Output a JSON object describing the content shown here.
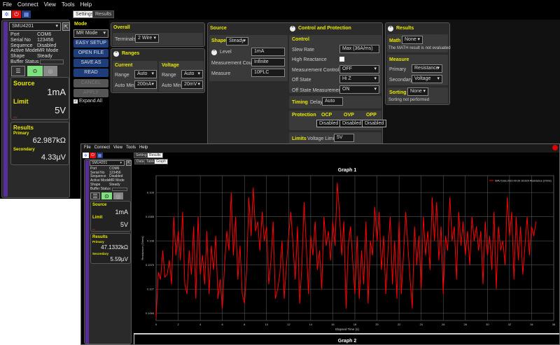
{
  "menu": [
    "File",
    "Connect",
    "View",
    "Tools",
    "Help"
  ],
  "tabs": {
    "settings": "Settings",
    "results": "Results",
    "data": "Data",
    "table": "Table",
    "graph": "Graph"
  },
  "device": {
    "name": "SMU4201",
    "fields": [
      {
        "k": "Port",
        "v": "COM6"
      },
      {
        "k": "Serial No",
        "v": "123456"
      },
      {
        "k": "Sequence",
        "v": "Disabled"
      },
      {
        "k": "Active Mode",
        "v": "MR Mode"
      },
      {
        "k": "Shape",
        "v": "Steady"
      },
      {
        "k": "Buffer Status",
        "v": ""
      }
    ]
  },
  "status": {
    "source_label": "Source",
    "source_value": "1mA",
    "limit_label": "Limit",
    "limit_value": "5V",
    "hv": "HV",
    "results_label": "Results",
    "primary_label": "Primary",
    "primary_value": "62.987kΩ",
    "secondary_label": "Secondary",
    "secondary_value": "4.33µV"
  },
  "status2": {
    "primary_value": "47.1332kΩ",
    "secondary_value": "5.59µV"
  },
  "mode": {
    "label": "Mode",
    "value": "MR Mode",
    "buttons": [
      "EASY SETUP",
      "OPEN FILE",
      "SAVE AS",
      "READ",
      "CANCEL",
      "APPLY"
    ],
    "expand_all": "Expand All"
  },
  "overall": {
    "title": "Overall",
    "terminals_label": "Terminals",
    "terminals": "2 Wire"
  },
  "ranges": {
    "title": "Ranges",
    "current": "Current",
    "voltage": "Voltage",
    "range": "Range",
    "automin": "Auto Min",
    "cur_range": "Auto",
    "cur_min": "200nA",
    "volt_range": "Auto",
    "volt_min": "20mV"
  },
  "source": {
    "title": "Source",
    "shape_label": "Shape",
    "shape": "Steady",
    "level_label": "Level",
    "level": "1mA",
    "count_label": "Measurement Count",
    "count": "Infinite",
    "measure_label": "Measure",
    "measure": "10PLC"
  },
  "control": {
    "title": "Control and Protection",
    "control": "Control",
    "slew_label": "Slew Rate",
    "slew": "Max (36A/ms)",
    "hr_label": "High Reactance",
    "mc_label": "Measurement Control",
    "mc": "OFF",
    "off_label": "Off State",
    "off": "Hi Z",
    "osm_label": "Off State Measurements",
    "osm": "ON",
    "timing": "Timing",
    "delay_label": "Delay",
    "delay": "Auto",
    "protection": "Protection",
    "ocp": "OCP",
    "ovp": "OVP",
    "opp": "OPP",
    "disabled": "Disabled",
    "limits": "Limits",
    "vlimit_label": "Voltage Limit",
    "vlimit": "5V"
  },
  "results": {
    "title": "Results",
    "math_label": "Math",
    "math": "None",
    "math_note": "The MATH result is not evaluated",
    "measure": "Measure",
    "primary_label": "Primary",
    "primary": "Resistance",
    "secondary_label": "Secondary",
    "secondary": "Voltage",
    "sorting_label": "Sorting",
    "sorting": "None",
    "sorting_note": "Sorting not performed"
  },
  "graph2_title": "Graph 2",
  "colors": {
    "series": "#ff0000",
    "accent": "#e8e800",
    "mode_bar": "#5a2d9c"
  },
  "chart_data": {
    "type": "line",
    "title": "Graph 1",
    "xlabel": "Elapsed Time (s)",
    "ylabel": "Resistance (Ohms)",
    "xlim": [
      0,
      36
    ],
    "ylim": [
      0.10635,
      0.10935
    ],
    "xticks": [
      0,
      2,
      4,
      6,
      8,
      10,
      12,
      14,
      16,
      18,
      20,
      22,
      24,
      26,
      28,
      30,
      32,
      34,
      36
    ],
    "yticks": [
      0.1065,
      0.107,
      0.1075,
      0.108,
      0.1085,
      0.109
    ],
    "ytick_labels": [
      "0.1065",
      "0.107",
      "0.1075",
      "0.108",
      "0.1085",
      "0.109"
    ],
    "legend": "SMU Data 2022-09-26 161020 Resistance (Ohms)",
    "legend_position": "top-right",
    "grid": true,
    "series": [
      {
        "name": "SMU Data 2022-09-26 161020 Resistance (Ohms)",
        "x_step": 0.2,
        "values": [
          0.1064,
          0.10735,
          0.1072,
          0.1078,
          0.10725,
          0.1073,
          0.1076,
          0.1071,
          0.1085,
          0.1077,
          0.1082,
          0.1076,
          0.1086,
          0.1071,
          0.1069,
          0.1078,
          0.1073,
          0.1083,
          0.1068,
          0.1085,
          0.1073,
          0.1077,
          0.1071,
          0.1082,
          0.1069,
          0.1079,
          0.1074,
          0.1081,
          0.1068,
          0.1072,
          0.1066,
          0.1075,
          0.1082,
          0.1078,
          0.109,
          0.1077,
          0.1085,
          0.1072,
          0.1079,
          0.1069,
          0.1067,
          0.1074,
          0.1089,
          0.1081,
          0.1091,
          0.1082,
          0.1084,
          0.1078,
          0.1086,
          0.108,
          0.1083,
          0.1071,
          0.1076,
          0.1084,
          0.1068,
          0.107,
          0.1073,
          0.108,
          0.1068,
          0.1075,
          0.1081,
          0.1086,
          0.1079,
          0.1072,
          0.1083,
          0.1067,
          0.1075,
          0.1088,
          0.1079,
          0.1069,
          0.1081,
          0.1077,
          0.1084,
          0.1074,
          0.1078,
          0.107,
          0.1085,
          0.1079,
          0.1082,
          0.1076,
          0.1084,
          0.1079,
          0.1092,
          0.1086,
          0.1077,
          0.1084,
          0.1066,
          0.1079,
          0.1083,
          0.1076,
          0.1069,
          0.1081,
          0.1068,
          0.1078,
          0.1071,
          0.1084,
          0.1067,
          0.108,
          0.1077,
          0.1087,
          0.108,
          0.1086,
          0.1074,
          0.1081,
          0.1069,
          0.1078,
          0.1085,
          0.1071,
          0.108,
          0.1068,
          0.1084,
          0.1069,
          0.1077,
          0.1086,
          0.1079,
          0.1072,
          0.1066,
          0.1083,
          0.1075,
          0.1081,
          0.107,
          0.1085,
          0.1077,
          0.1082,
          0.1074,
          0.1089,
          0.108,
          0.1088,
          0.1076,
          0.1083,
          0.1069,
          0.1081,
          0.1078,
          0.1089,
          0.108,
          0.1083,
          0.1072,
          0.1086,
          0.1079,
          0.1084,
          0.1077,
          0.1082,
          0.1075,
          0.1085,
          0.108,
          0.1083,
          0.1078,
          0.1082,
          0.1071,
          0.1084,
          0.1077,
          0.1081,
          0.1074,
          0.1086,
          0.107,
          0.1083,
          0.1078,
          0.108,
          0.1075,
          0.1089,
          0.1081,
          0.1086,
          0.1072,
          0.1085,
          0.1076,
          0.1083,
          0.1073,
          0.1079,
          0.1085,
          0.1077,
          0.1083,
          0.1081,
          0.1084
        ]
      }
    ]
  }
}
